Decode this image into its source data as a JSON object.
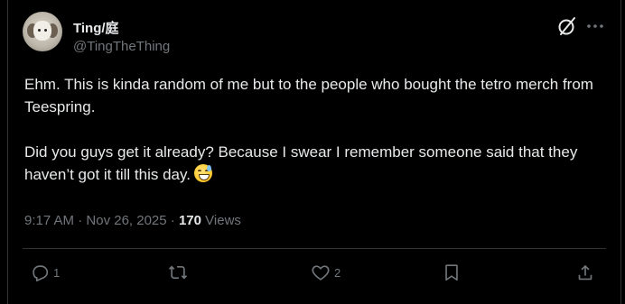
{
  "author": {
    "display_name": "Ting/庭",
    "handle": "@TingTheThing",
    "avatar_icon": "avatar-plush-character"
  },
  "header_icons": {
    "grok": "grok-icon",
    "more": "more-icon"
  },
  "tweet": {
    "text_part1": "Ehm. This is kinda random of me but to the people who bought the tetro merch from Teespring.\n\nDid you guys get it already? Because I swear I remember someone said that they haven’t got it till this day.",
    "emoji": "grinning-face-with-sweat-emoji"
  },
  "meta": {
    "time": "9:17 AM",
    "separator1": " · ",
    "date": "Nov 26, 2025",
    "separator2": " · ",
    "views_count": "170",
    "views_label": " Views"
  },
  "actions": {
    "replies": "1",
    "reposts": "",
    "likes": "2"
  },
  "colors": {
    "background": "#000000",
    "text_primary": "#e7e9ea",
    "text_secondary": "#71767b",
    "border": "#2f3336"
  }
}
